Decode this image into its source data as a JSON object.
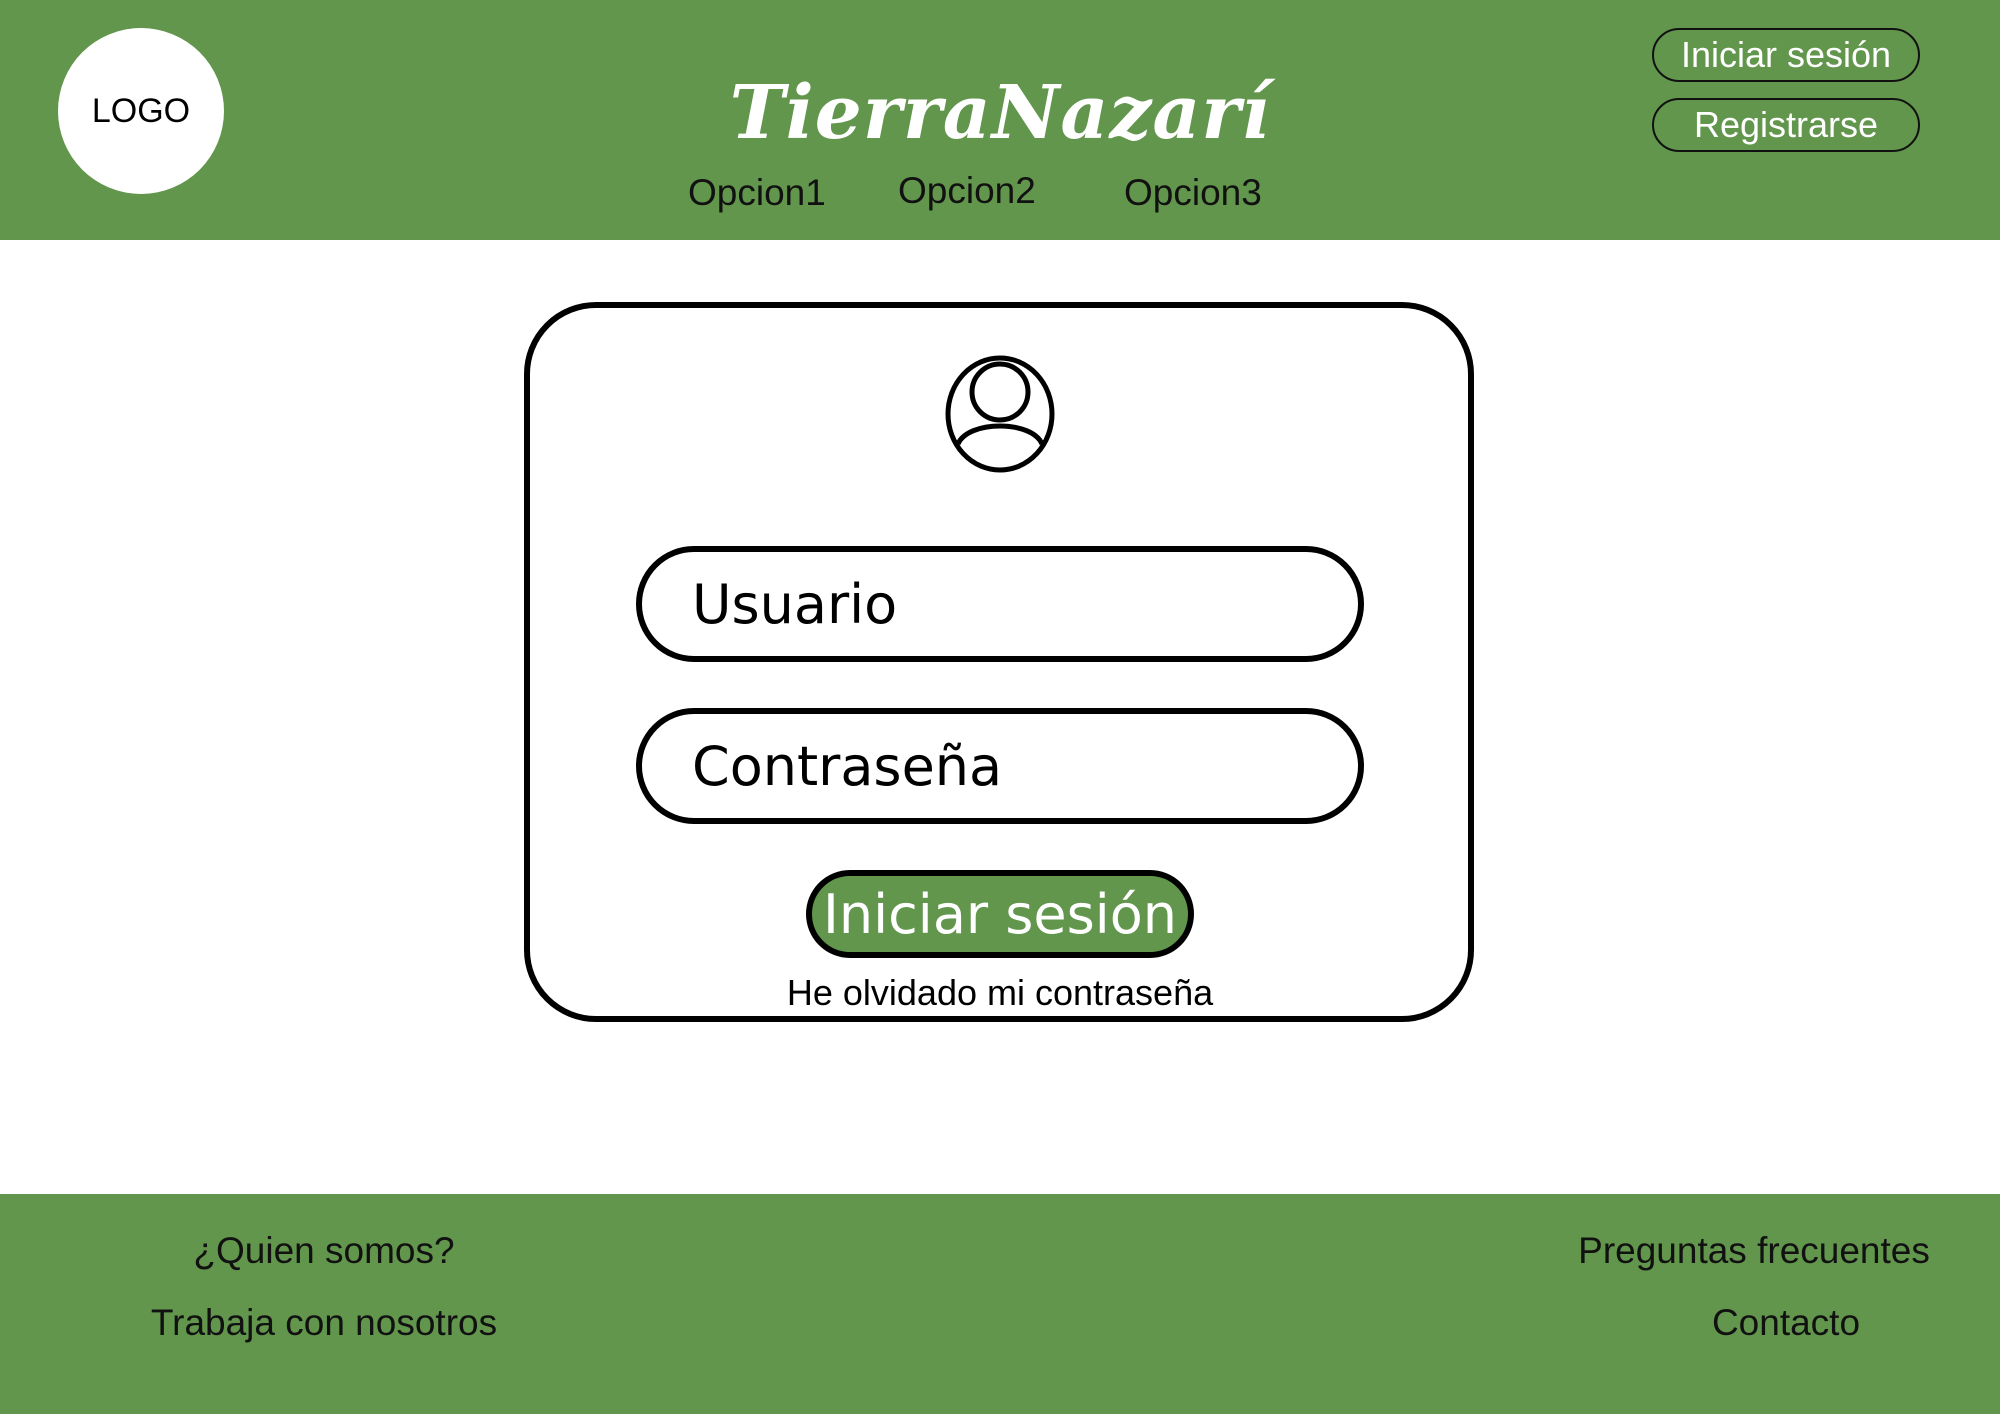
{
  "header": {
    "logo_text": "LOGO",
    "brand": "TierraNazarí",
    "nav": [
      "Opcion1",
      "Opcion2",
      "Opcion3"
    ],
    "login_button": "Iniciar sesión",
    "register_button": "Registrarse"
  },
  "login_card": {
    "avatar_icon": "user-circle-icon",
    "username_placeholder": "Usuario",
    "password_placeholder": "Contraseña",
    "submit_label": "Iniciar sesión",
    "forgot_password": "He olvidado mi contraseña"
  },
  "footer": {
    "about": "¿Quien somos?",
    "jobs": "Trabaja con nosotros",
    "faq": "Preguntas frecuentes",
    "contact": "Contacto"
  },
  "colors": {
    "primary_green": "#62964c",
    "background": "#ffffff",
    "outline": "#000000"
  }
}
